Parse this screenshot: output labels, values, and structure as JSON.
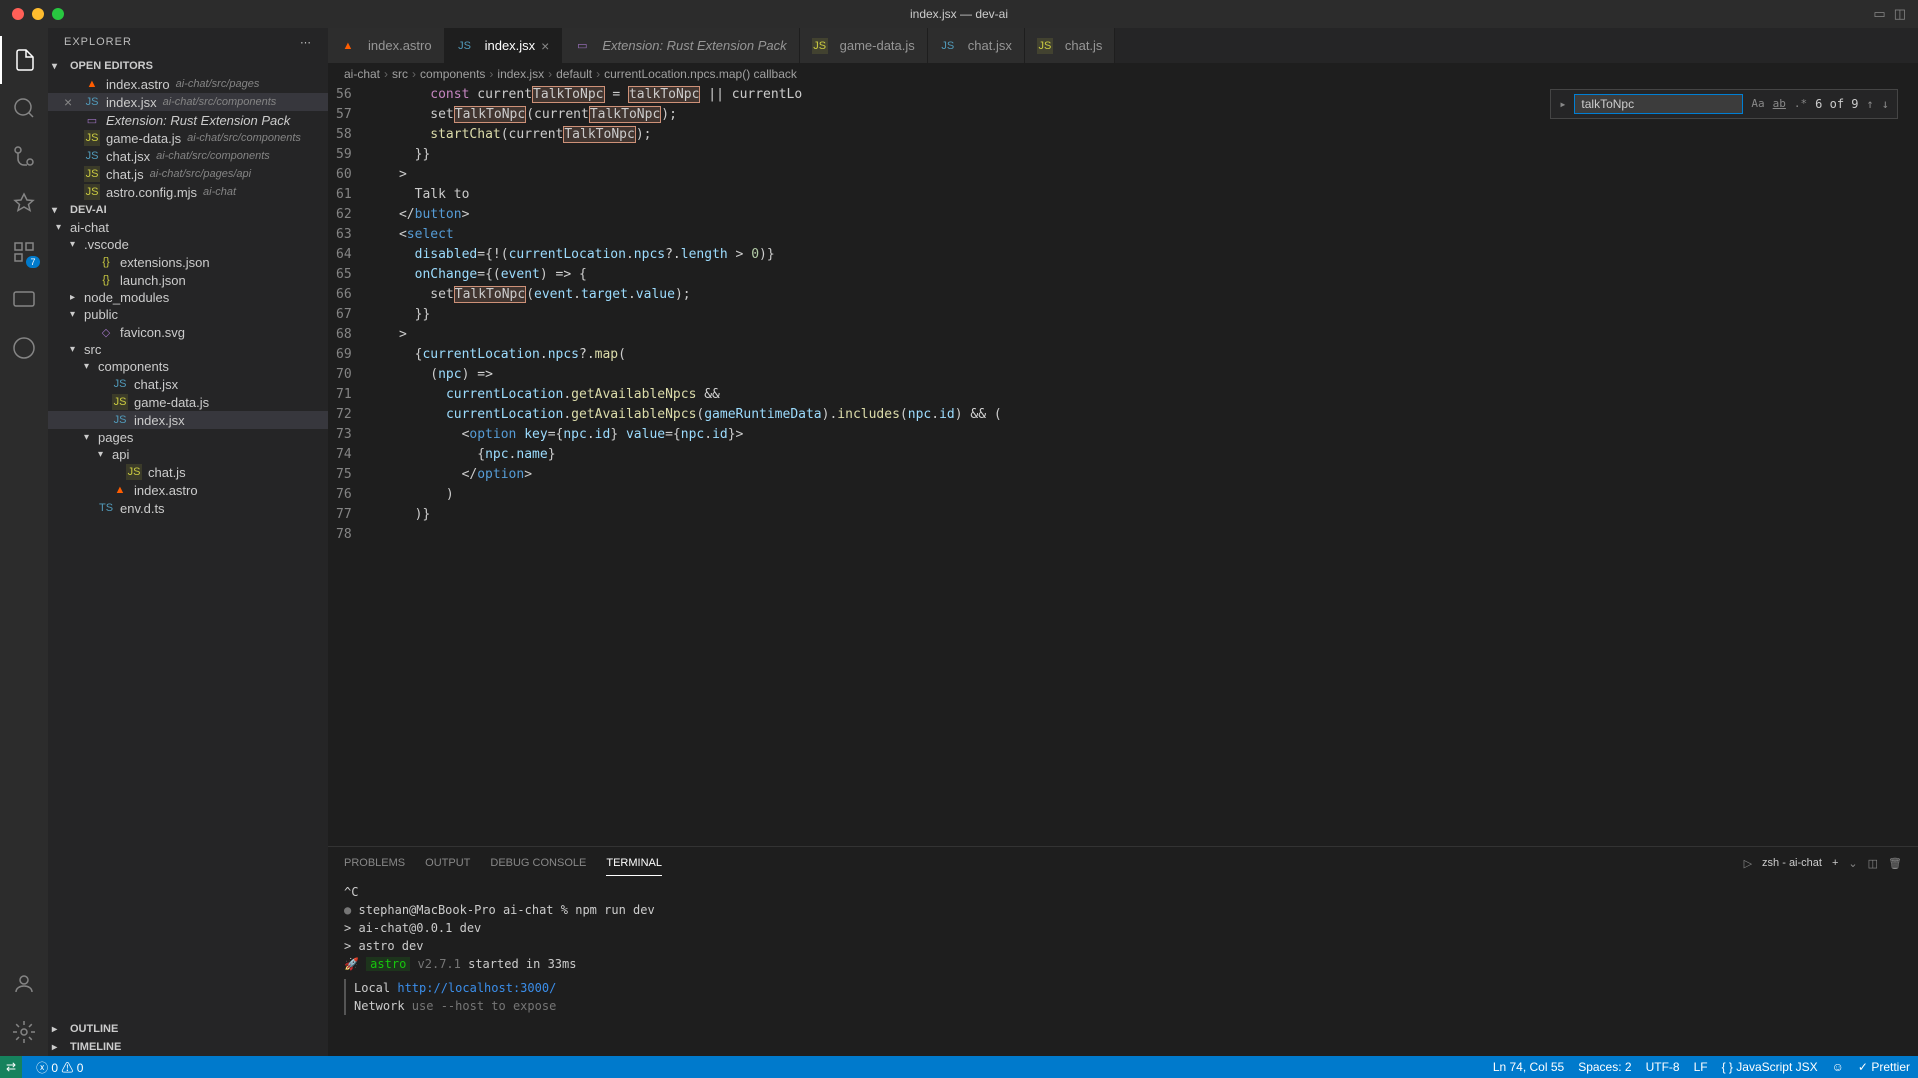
{
  "window": {
    "title": "index.jsx — dev-ai"
  },
  "explorer": {
    "title": "EXPLORER",
    "openEditorsTitle": "OPEN EDITORS",
    "openEditors": [
      {
        "name": "index.astro",
        "path": "ai-chat/src/pages",
        "icon": "astro",
        "dirty": false,
        "italic": false
      },
      {
        "name": "index.jsx",
        "path": "ai-chat/src/components",
        "icon": "jsx",
        "dirty": false,
        "italic": false,
        "active": true
      },
      {
        "name": "Extension: Rust Extension Pack",
        "path": "",
        "icon": "ext",
        "dirty": false,
        "italic": true
      },
      {
        "name": "game-data.js",
        "path": "ai-chat/src/components",
        "icon": "js",
        "dirty": false
      },
      {
        "name": "chat.jsx",
        "path": "ai-chat/src/components",
        "icon": "jsx",
        "dirty": false
      },
      {
        "name": "chat.js",
        "path": "ai-chat/src/pages/api",
        "icon": "js",
        "dirty": false
      },
      {
        "name": "astro.config.mjs",
        "path": "ai-chat",
        "icon": "js",
        "dirty": false
      }
    ],
    "workspaceName": "DEV-AI",
    "tree": [
      {
        "name": "ai-chat",
        "type": "folder",
        "indent": 0,
        "open": true
      },
      {
        "name": ".vscode",
        "type": "folder",
        "indent": 1,
        "open": true
      },
      {
        "name": "extensions.json",
        "type": "file",
        "indent": 2,
        "icon": "json"
      },
      {
        "name": "launch.json",
        "type": "file",
        "indent": 2,
        "icon": "json"
      },
      {
        "name": "node_modules",
        "type": "folder",
        "indent": 1,
        "open": false
      },
      {
        "name": "public",
        "type": "folder",
        "indent": 1,
        "open": true
      },
      {
        "name": "favicon.svg",
        "type": "file",
        "indent": 2,
        "icon": "svg"
      },
      {
        "name": "src",
        "type": "folder",
        "indent": 1,
        "open": true
      },
      {
        "name": "components",
        "type": "folder",
        "indent": 2,
        "open": true
      },
      {
        "name": "chat.jsx",
        "type": "file",
        "indent": 3,
        "icon": "jsx"
      },
      {
        "name": "game-data.js",
        "type": "file",
        "indent": 3,
        "icon": "js"
      },
      {
        "name": "index.jsx",
        "type": "file",
        "indent": 3,
        "icon": "jsx",
        "selected": true
      },
      {
        "name": "pages",
        "type": "folder",
        "indent": 2,
        "open": true
      },
      {
        "name": "api",
        "type": "folder",
        "indent": 3,
        "open": true
      },
      {
        "name": "chat.js",
        "type": "file",
        "indent": 4,
        "icon": "js"
      },
      {
        "name": "index.astro",
        "type": "file",
        "indent": 3,
        "icon": "astro"
      },
      {
        "name": "env.d.ts",
        "type": "file",
        "indent": 2,
        "icon": "ts"
      }
    ],
    "outlineTitle": "OUTLINE",
    "timelineTitle": "TIMELINE"
  },
  "tabs": [
    {
      "label": "index.astro",
      "icon": "astro"
    },
    {
      "label": "index.jsx",
      "icon": "jsx",
      "active": true,
      "close": true
    },
    {
      "label": "Extension: Rust Extension Pack",
      "icon": "ext",
      "italic": true
    },
    {
      "label": "game-data.js",
      "icon": "js"
    },
    {
      "label": "chat.jsx",
      "icon": "jsx"
    },
    {
      "label": "chat.js",
      "icon": "js"
    }
  ],
  "breadcrumbs": [
    "ai-chat",
    "src",
    "components",
    "index.jsx",
    "default",
    "currentLocation.npcs.map() callback"
  ],
  "find": {
    "value": "talkToNpc",
    "result": "6 of 9"
  },
  "lineStart": 56,
  "lineEnd": 78,
  "code": {
    "56": "        const currentTalkToNpc = talkToNpc || currentLo",
    "57": "        setTalkToNpc(currentTalkToNpc);",
    "58": "",
    "59": "        startChat(currentTalkToNpc);",
    "60": "      }}",
    "61": "    >",
    "62": "      Talk to",
    "63": "    </button>",
    "64": "    <select",
    "65": "      disabled={!(currentLocation.npcs?.length > 0)}",
    "66": "      onChange={(event) => {",
    "67": "        setTalkToNpc(event.target.value);",
    "68": "      }}",
    "69": "    >",
    "70": "      {currentLocation.npcs?.map(",
    "71": "        (npc) =>",
    "72": "          currentLocation.getAvailableNpcs &&",
    "73": "          currentLocation.getAvailableNpcs(gameRuntimeData).includes(npc.id) && (",
    "74": "            <option key={npc.id} value={npc.id}>",
    "75": "              {npc.name}",
    "76": "            </option>",
    "77": "          )",
    "78": "      )}"
  },
  "panel": {
    "tabs": [
      "PROBLEMS",
      "OUTPUT",
      "DEBUG CONSOLE",
      "TERMINAL"
    ],
    "activeTab": "TERMINAL",
    "terminalLabel": "zsh - ai-chat",
    "terminal": {
      "l1": "^C",
      "l2_prompt": "stephan@MacBook-Pro ai-chat % ",
      "l2_cmd": "npm run dev",
      "l3": "",
      "l4": "> ai-chat@0.0.1 dev",
      "l5": "> astro dev",
      "l6": "",
      "l7_rocket": "🚀 ",
      "l7_astro": "astro",
      "l7_ver": "  v2.7.1 ",
      "l7_rest": "started in 33ms",
      "l8_lbl": "  Local   ",
      "l8_url": "http://localhost:3000/",
      "l9_lbl": "  Network ",
      "l9_rest": "use --host to expose"
    }
  },
  "statusbar": {
    "errors": "0",
    "warnings": "0",
    "cursor": "Ln 74, Col 55",
    "spaces": "Spaces: 2",
    "encoding": "UTF-8",
    "eol": "LF",
    "lang": "JavaScript JSX",
    "prettier": "Prettier"
  },
  "activityBadge": "7"
}
